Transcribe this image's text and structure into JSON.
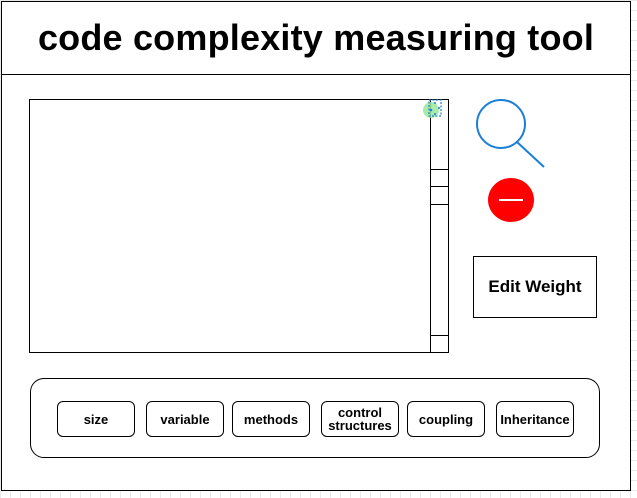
{
  "header": {
    "title": "code complexity measuring tool"
  },
  "toolbar": {
    "search_icon": "search-icon",
    "remove_icon": "minus-circle-icon",
    "remove_color": "#ff0000",
    "search_color": "#1a7fd8",
    "edit_weight_label": "Edit Weight"
  },
  "metrics": {
    "size_label": "size",
    "variable_label": "variable",
    "methods_label": "methods",
    "control_label_line1": "control",
    "control_label_line2": "structures",
    "coupling_label": "coupling",
    "inheritance_label": "Inheritance"
  }
}
